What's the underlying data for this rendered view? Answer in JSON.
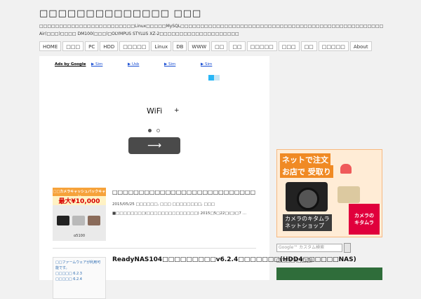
{
  "site": {
    "title": "□□□□□□□□□□□□□□ □□□",
    "description": "□□□□□□□□□□□□□□□□□□□□□□□□Linux□□□□□MySQL□□□□□□□□□□□□□□□□□□□□□□□□□□□□□□□□□□□□□□□□□□□□□□□□□□□MacBookAir(13□)□iPad Air(□□□)□□□□ DM100(□□□)□OLYMPUS STYLUS XZ-2□□□□□□□□□□□□□□□□□□□□"
  },
  "nav": [
    "HOME",
    "□□□",
    "PC",
    "HDD",
    "□□□□□",
    "Linux",
    "DB",
    "WWW",
    "□□",
    "□□",
    "□□□□□",
    "□□□",
    "□□",
    "□□□□□",
    "About"
  ],
  "ad": {
    "ads_by": "Ads by Google",
    "links": [
      "▶ Sim",
      "▶ Usb",
      "▶ Sim",
      "▶ Sim"
    ],
    "wifi_text": "WiFi",
    "plus": "+",
    "next_arrow": "⟶"
  },
  "posts": [
    {
      "title": "□□□□□□□□□□□□□□□□□□□□□□□□□□□",
      "thumb_top": "□□カメラキャッシュバックキャン",
      "thumb_amount": "最大¥10,000",
      "thumb_model": "α5100",
      "meta": "2015/05/25 □□□□□□, □□□ □□□□□□□□, □□□",
      "excerpt": "■□□□□□□□□(□□□□□□□□□□□□□□) 2015□5□22□(□)□7 …"
    },
    {
      "title": "ReadyNAS104□□□□□□□□□v6.2.4□□□□□□□(HDD4□□□□□□NAS)",
      "thumb_text": "□□ファームウェアが利用可能です。\n□□□□□ 6.2.3\n□□□□□ 6.2.4"
    }
  ],
  "sidebar": {
    "banner_line1": "ネットで注文",
    "banner_line2": "お店で 受取り",
    "banner_line3": "カメラのキタムラ\nネットショップ",
    "banner_logo": "カメラの\nキタムラ",
    "search_placeholder": "Google™ カスタム検索",
    "heading": "□□□□(□□□)"
  },
  "colors": {
    "background": "#f1f1f1",
    "link": "#1a4fd3",
    "dark_button": "#4a4a4a",
    "banner_orange": "#f08a24"
  }
}
